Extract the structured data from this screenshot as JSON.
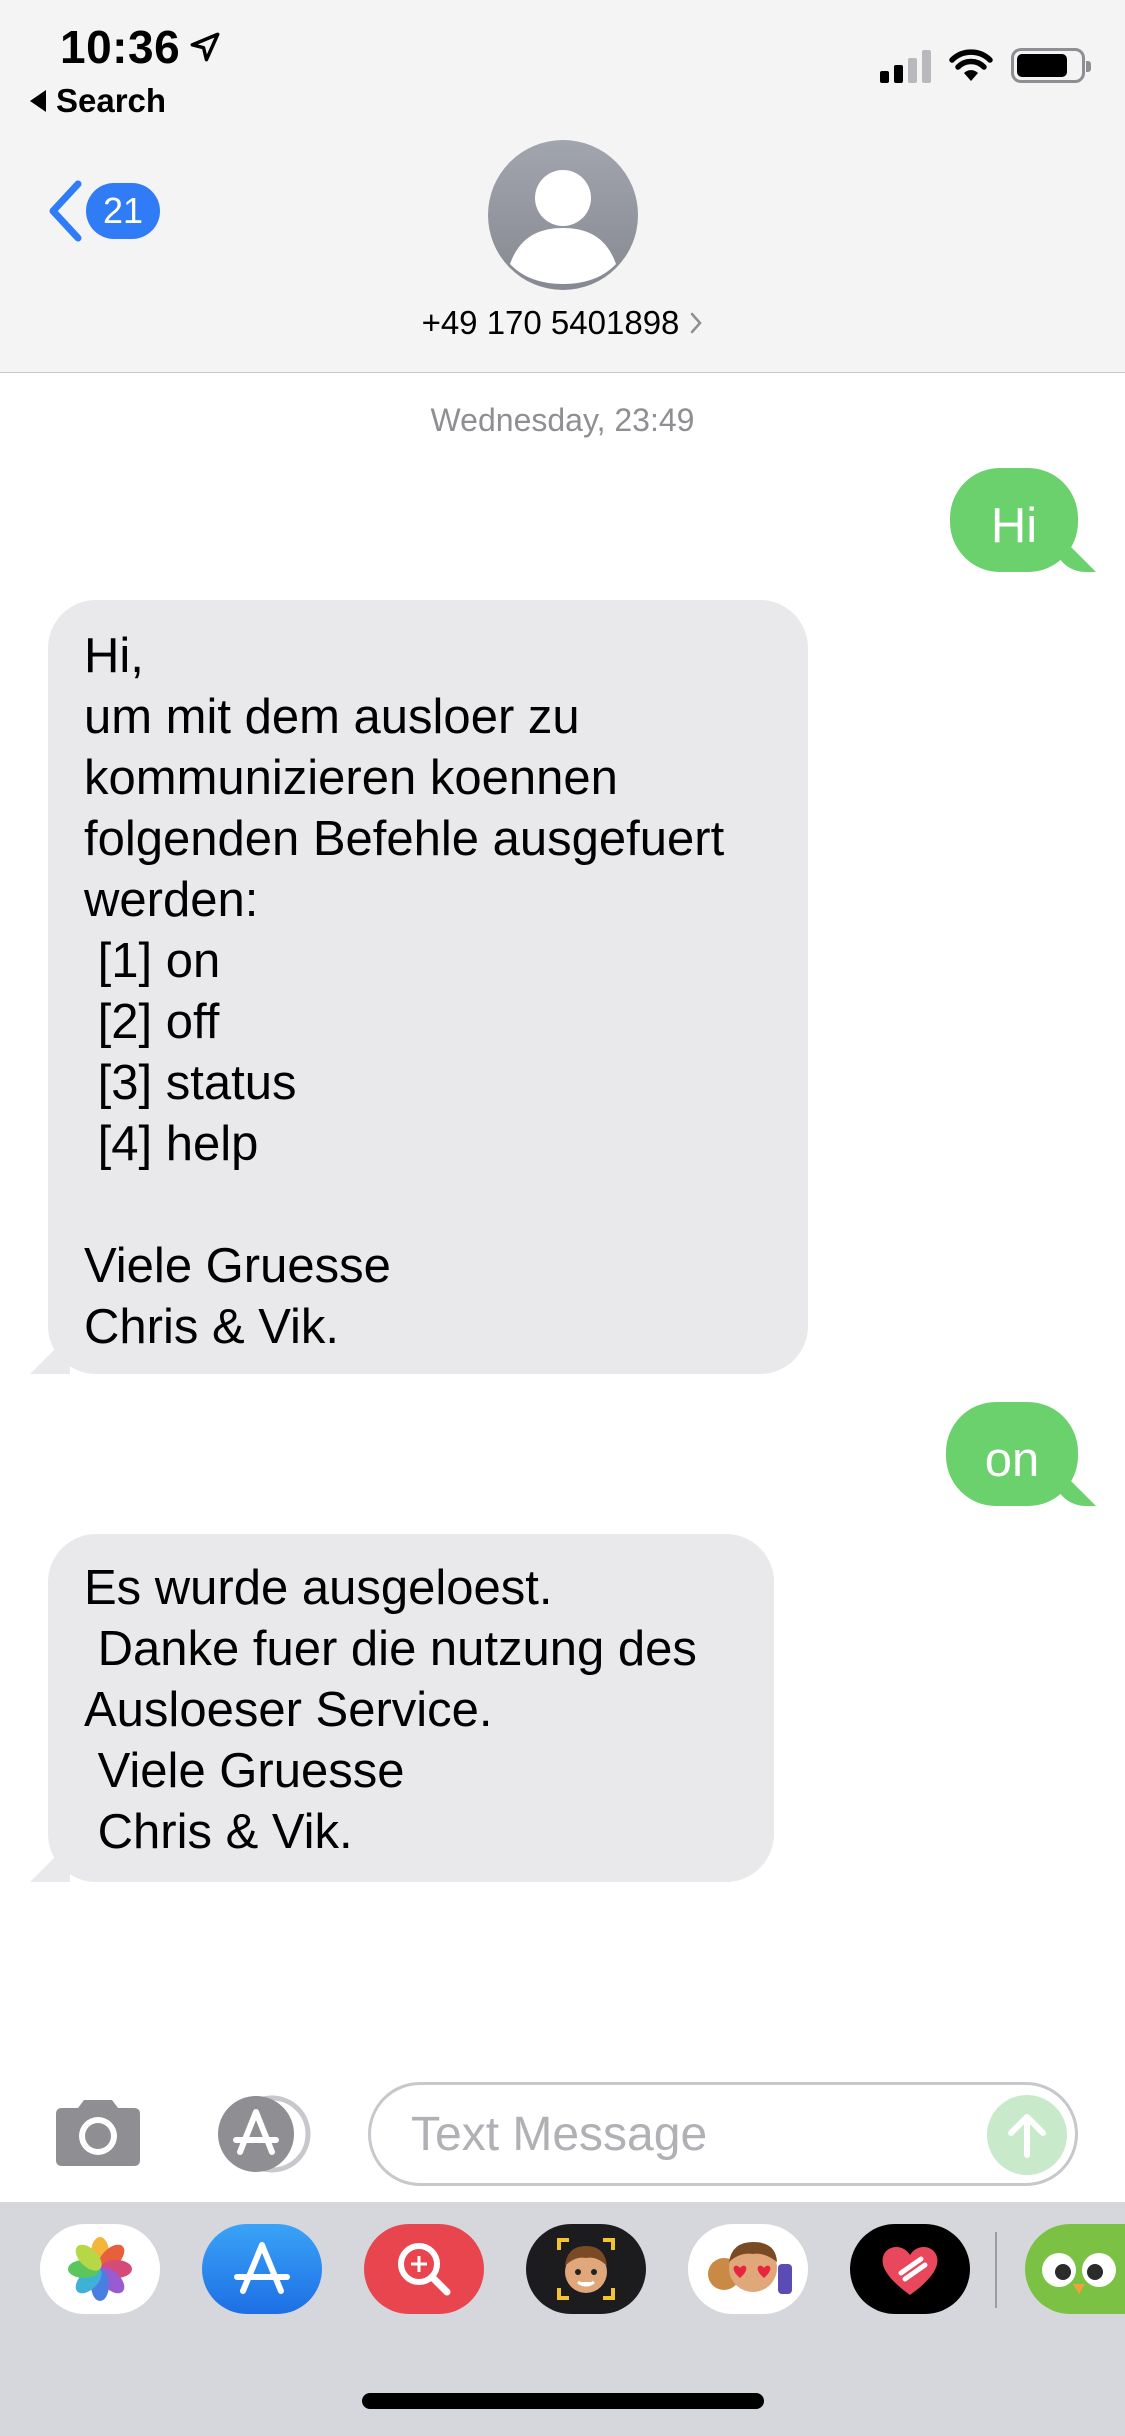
{
  "status_bar": {
    "time": "10:36",
    "back_app_label": "Search"
  },
  "nav": {
    "unread_count": "21",
    "contact_number": "+49 170 5401898"
  },
  "conversation": {
    "timestamp": "Wednesday, 23:49",
    "messages": [
      {
        "direction": "outgoing",
        "text": "Hi"
      },
      {
        "direction": "incoming",
        "text": "Hi,\num mit dem ausloer zu\nkommunizieren koennen\nfolgenden Befehle ausgefuert\nwerden:\n [1] on\n [2] off\n [3] status\n [4] help\n\nViele Gruesse\nChris & Vik."
      },
      {
        "direction": "outgoing",
        "text": "on"
      },
      {
        "direction": "incoming",
        "text": "Es wurde ausgeloest.\n Danke fuer die nutzung des\nAusloeser Service.\n Viele Gruesse\n Chris & Vik."
      }
    ]
  },
  "composer": {
    "placeholder": "Text Message"
  },
  "app_drawer": {
    "apps": [
      "photos-app-icon",
      "app-store-icon",
      "search-images-icon",
      "memoji-icon",
      "animoji-stickers-icon",
      "digital-touch-icon",
      "duolingo-icon"
    ]
  },
  "colors": {
    "outgoing_bubble": "#6ad16d",
    "incoming_bubble": "#e9e9eb",
    "accent_blue": "#2f7cf6",
    "timestamp_gray": "#8e8e93"
  }
}
